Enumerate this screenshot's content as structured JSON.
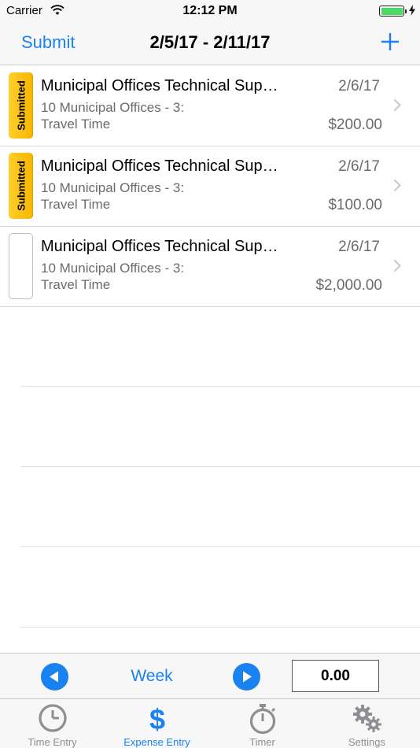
{
  "status_bar": {
    "carrier": "Carrier",
    "time": "12:12 PM"
  },
  "nav": {
    "submit_label": "Submit",
    "title": "2/5/17 - 2/11/17",
    "add_icon": "plus-icon"
  },
  "expenses": [
    {
      "status": "Submitted",
      "title": "Municipal Offices Technical Sup…",
      "subtitle": "10 Municipal Offices - 3:",
      "category": "Travel Time",
      "date": "2/6/17",
      "amount": "$200.00"
    },
    {
      "status": "Submitted",
      "title": "Municipal Offices Technical Sup…",
      "subtitle": "10 Municipal Offices - 3:",
      "category": "Travel Time",
      "date": "2/6/17",
      "amount": "$100.00"
    },
    {
      "status": "",
      "title": "Municipal Offices Technical Sup…",
      "subtitle": "10 Municipal Offices - 3:",
      "category": "Travel Time",
      "date": "2/6/17",
      "amount": "$2,000.00"
    }
  ],
  "week_bar": {
    "label": "Week",
    "total": "0.00"
  },
  "tabs": [
    {
      "label": "Time Entry",
      "icon": "clock-icon",
      "active": false
    },
    {
      "label": "Expense Entry",
      "icon": "dollar-icon",
      "active": true
    },
    {
      "label": "Timer",
      "icon": "stopwatch-icon",
      "active": false
    },
    {
      "label": "Settings",
      "icon": "gears-icon",
      "active": false
    }
  ],
  "colors": {
    "accent": "#1a82f0",
    "submitted_badge": "#f7b500"
  }
}
